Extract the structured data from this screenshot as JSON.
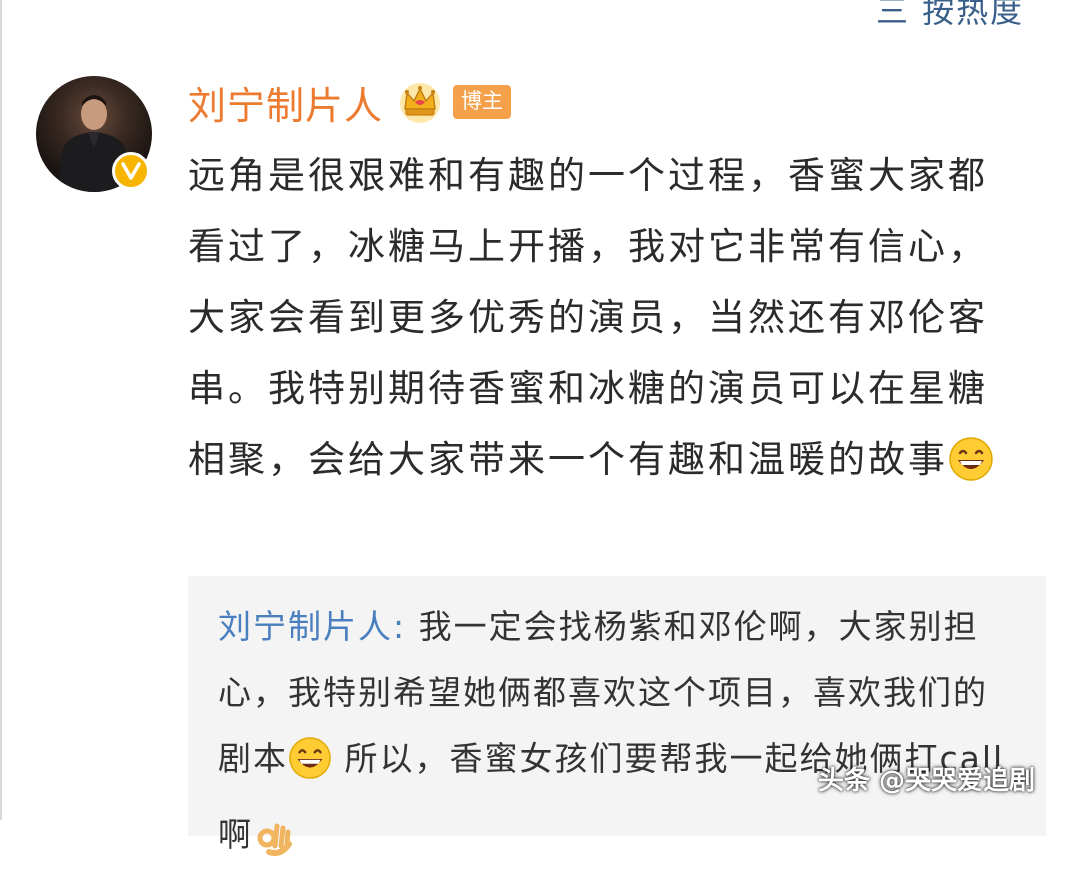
{
  "top_bar": {
    "sort_label": "三 按热度"
  },
  "post": {
    "author": "刘宁制片人",
    "role_badge": "博主",
    "crown_icon": "crown-icon",
    "verified_icon": "verified-v-icon",
    "body_text": "远角是很艰难和有趣的一个过程，香蜜大家都看过了，冰糖马上开播，我对它非常有信心，大家会看到更多优秀的演员，当然还有邓伦客串。我特别期待香蜜和冰糖的演员可以在星糖相聚，会给大家带来一个有趣和温暖的故事",
    "body_emoji": "grinning-face-emoji"
  },
  "reply": {
    "author": "刘宁制片人",
    "separator": ":",
    "text_before_emoji": " 我一定会找杨紫和邓伦啊，大家别担心，我特别希望她俩都喜欢这个项目，喜欢我们的剧本",
    "text_after_emoji": " 所以，香蜜女孩们要帮我一起给她俩打call啊",
    "emoji": "grinning-face-emoji",
    "trailing_emoji": "ok-hand-emoji"
  },
  "watermark": "头条 @哭哭爱追剧",
  "colors": {
    "author_orange": "#ec7a2f",
    "badge_orange": "#f5a04a",
    "verified_gold": "#f7b500",
    "reply_author_blue": "#4a7fbf",
    "reply_bg": "#f4f4f4",
    "body_text": "#2b2b2b"
  }
}
